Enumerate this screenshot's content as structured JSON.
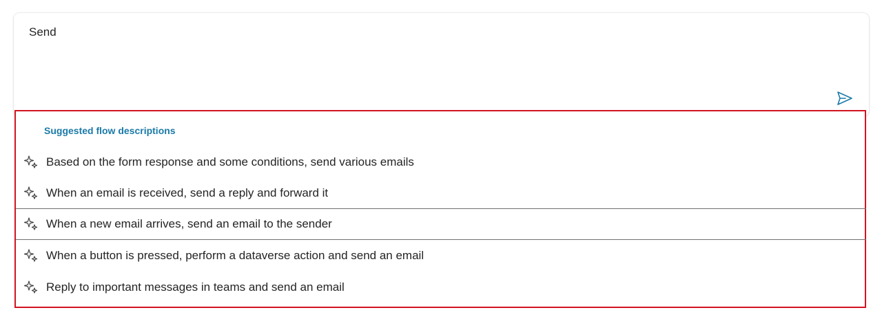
{
  "composer": {
    "value": "Send",
    "send_icon": "send-icon"
  },
  "suggestions": {
    "header": "Suggested flow descriptions",
    "icon": "sparkle-icon",
    "items": [
      {
        "label": "Based on the form response and some conditions, send various emails"
      },
      {
        "label": "When an email is received, send a reply and forward it"
      },
      {
        "label": "When a new email arrives, send an email to the sender"
      },
      {
        "label": "When a button is pressed, perform a dataverse action and send an email"
      },
      {
        "label": "Reply to important messages in teams and send an email"
      }
    ],
    "selected_index": 2
  },
  "colors": {
    "highlight_border": "#d3121f",
    "header_text": "#1a7aa8",
    "send_icon": "#1a7aa8"
  }
}
